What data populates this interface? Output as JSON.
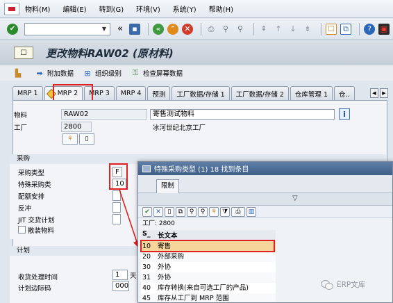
{
  "menu": [
    "物料(M)",
    "编辑(E)",
    "转到(G)",
    "环境(V)",
    "系统(Y)",
    "帮助(H)"
  ],
  "toolbar": {
    "command_value": "",
    "icons": [
      "enter-icon",
      "back-icon",
      "save-icon",
      "exit-icon",
      "cancel-icon",
      "print-icon",
      "find-icon",
      "find-next-icon",
      "first-page-icon",
      "prev-page-icon",
      "next-page-icon",
      "last-page-icon",
      "create-session-icon",
      "shortcut-icon",
      "help-icon",
      "layout-icon"
    ]
  },
  "title": "更改物料RAW02 (原材料)",
  "app_toolbar": [
    "附加数据",
    "组织级别",
    "检查屏幕数据"
  ],
  "tabs": [
    "MRP 1",
    "MRP 2",
    "MRP 3",
    "MRP 4",
    "预测",
    "工厂数据/存储 1",
    "工厂数据/存储 2",
    "仓库管理 1",
    "仓.."
  ],
  "active_tab": "MRP 2",
  "header": {
    "material_label": "物料",
    "material_value": "RAW02",
    "material_desc": "寄售测试物料",
    "plant_label": "工厂",
    "plant_value": "2800",
    "plant_desc": "冰河世纪北京工厂"
  },
  "procurement": {
    "title": "采购",
    "fields": [
      {
        "label": "采购类型",
        "value": "F"
      },
      {
        "label": "特殊采购类",
        "value": "10"
      },
      {
        "label": "配额安排",
        "value": ""
      },
      {
        "label": "反冲",
        "value": ""
      },
      {
        "label": "JIT 交货计划",
        "value": ""
      }
    ],
    "bulk_label": "散装物料"
  },
  "planning": {
    "title": "计划",
    "fields": [
      {
        "label": "收货处理时间",
        "value": "1",
        "unit": "天"
      },
      {
        "label": "计划边际码",
        "value": "000"
      }
    ]
  },
  "popup": {
    "title": "特殊采购类型 (1)  18 找到条目",
    "tab": "限制",
    "filter": "工厂: 2800",
    "col_code": "S_",
    "col_text": "长文本",
    "rows": [
      {
        "code": "10",
        "text": "寄售"
      },
      {
        "code": "20",
        "text": "外部采购"
      },
      {
        "code": "30",
        "text": "外协"
      },
      {
        "code": "31",
        "text": "外协"
      },
      {
        "code": "40",
        "text": "库存转换(来自可选工厂的产品)"
      },
      {
        "code": "45",
        "text": "库存从工厂到 MRP 范围"
      }
    ],
    "selected_code": "10"
  },
  "watermark": "ERP文库"
}
